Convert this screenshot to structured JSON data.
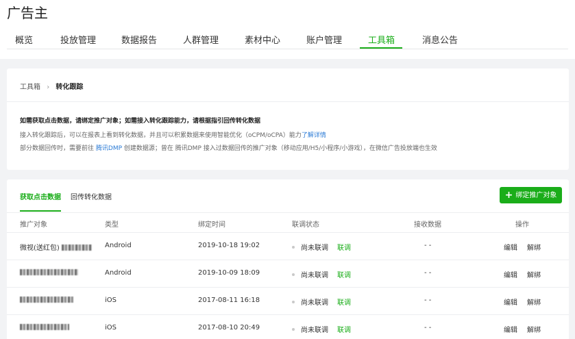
{
  "app": {
    "title": "广告主"
  },
  "nav": {
    "items": [
      {
        "label": "概览"
      },
      {
        "label": "投放管理"
      },
      {
        "label": "数据报告"
      },
      {
        "label": "人群管理"
      },
      {
        "label": "素材中心"
      },
      {
        "label": "账户管理"
      },
      {
        "label": "工具箱",
        "active": true
      },
      {
        "label": "消息公告"
      }
    ]
  },
  "breadcrumb": {
    "parent": "工具箱",
    "current": "转化跟踪"
  },
  "notice": {
    "title": "如需获取点击数据，请绑定推广对象；如需接入转化跟踪能力，请根据指引回传转化数据",
    "line1": "接入转化跟踪后，可以在报表上看到转化数据，并且可以积累数据来使用智能优化（oCPM/oCPA）能力",
    "line1_link": "了解详情",
    "line2_prefix": "部分数据回传时，需要前往",
    "line2_link": "腾讯DMP",
    "line2_suffix": "创建数据源；曾在 腾讯DMP 接入过数据回传的推广对象（移动应用/H5/小程序/小游戏），在微信广告投放端也生效"
  },
  "tabs": {
    "click_data": "获取点击数据",
    "conversion_data": "回传转化数据"
  },
  "bind_button": {
    "label": "绑定推广对象",
    "icon": "plus-icon"
  },
  "table": {
    "headers": {
      "target": "推广对象",
      "type": "类型",
      "time": "绑定时间",
      "status": "联调状态",
      "receive": "接收数据",
      "ops": "操作"
    },
    "rows": [
      {
        "name": "微视(送红包)",
        "type": "Android",
        "time": "2019-10-18 19:02",
        "status": "尚未联调",
        "action": "联调",
        "receive": "- -",
        "edit": "编辑",
        "unbind": "解绑"
      },
      {
        "name": "",
        "type": "Android",
        "time": "2019-10-09 18:09",
        "status": "尚未联调",
        "action": "联调",
        "receive": "- -",
        "edit": "编辑",
        "unbind": "解绑"
      },
      {
        "name": "",
        "type": "iOS",
        "time": "2017-08-11 16:18",
        "status": "尚未联调",
        "action": "联调",
        "receive": "- -",
        "edit": "编辑",
        "unbind": "解绑"
      },
      {
        "name": "",
        "type": "iOS",
        "time": "2017-08-10 20:49",
        "status": "尚未联调",
        "action": "联调",
        "receive": "- -",
        "edit": "编辑",
        "unbind": "解绑"
      }
    ]
  },
  "colors": {
    "accent": "#1aad19",
    "link": "#2b7bd6",
    "background": "#f2f3f5"
  }
}
